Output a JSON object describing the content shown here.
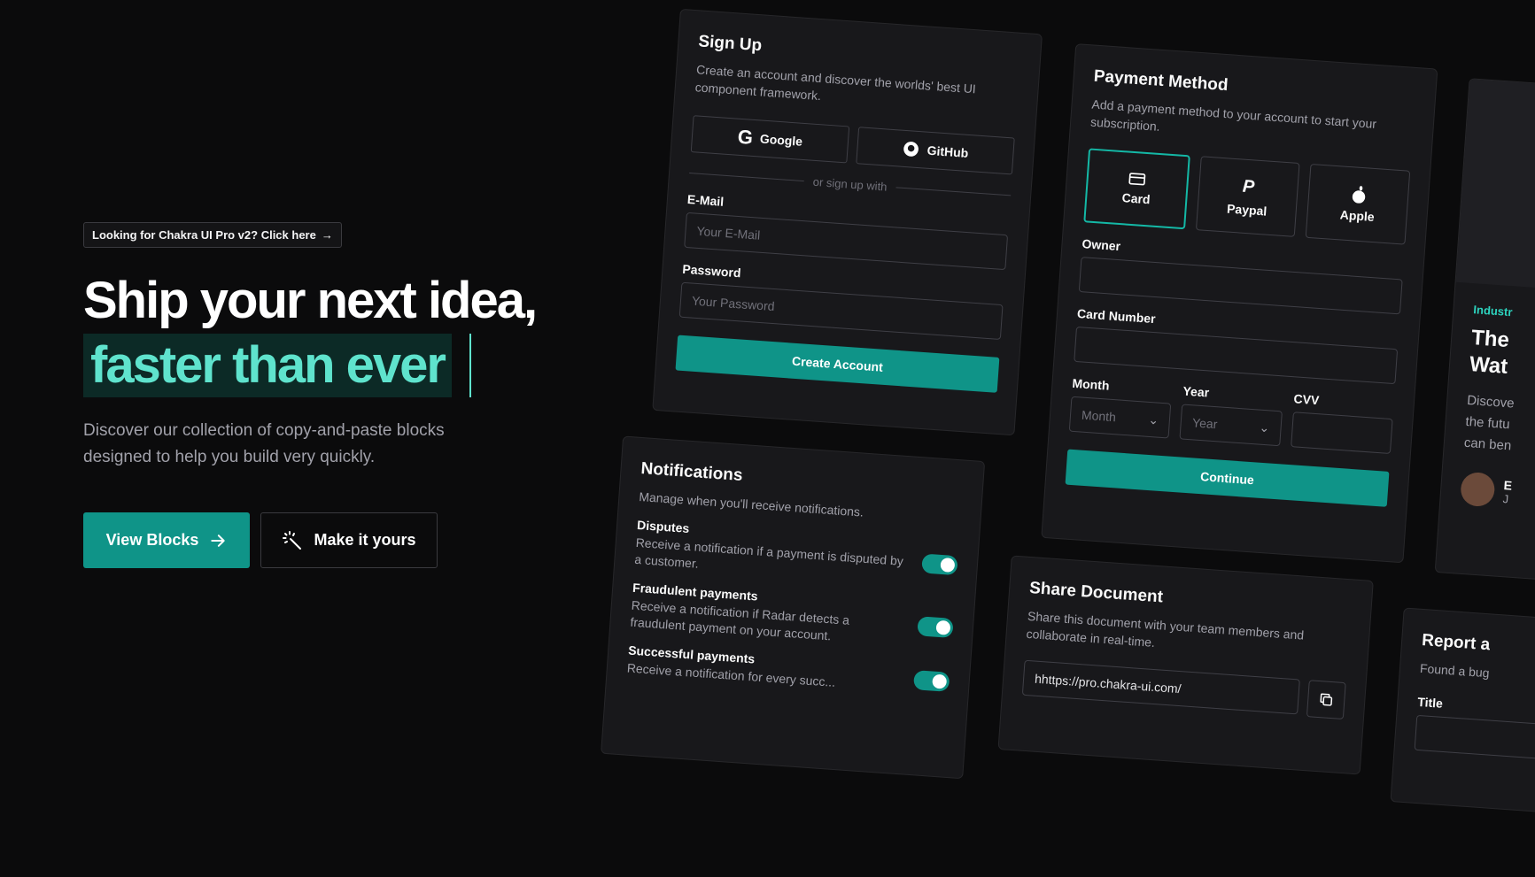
{
  "hero": {
    "promo_label": "Looking for Chakra UI Pro v2? Click here",
    "headline_line1": "Ship your next idea,",
    "headline_line2": "faster than ever",
    "subtitle": "Discover our collection of copy-and-paste blocks designed to help you build very quickly.",
    "primary_button": "View Blocks",
    "secondary_button": "Make it yours"
  },
  "signup": {
    "title": "Sign Up",
    "description": "Create an account and discover the worlds' best UI component framework.",
    "google_label": "Google",
    "github_label": "GitHub",
    "divider": "or sign up with",
    "email_label": "E-Mail",
    "email_placeholder": "Your E-Mail",
    "password_label": "Password",
    "password_placeholder": "Your Password",
    "submit": "Create Account"
  },
  "payment": {
    "title": "Payment Method",
    "description": "Add a payment method to your account to start your subscription.",
    "options": [
      {
        "label": "Card",
        "icon": "card-icon",
        "selected": true
      },
      {
        "label": "Paypal",
        "icon": "paypal-icon",
        "selected": false
      },
      {
        "label": "Apple",
        "icon": "apple-icon",
        "selected": false
      }
    ],
    "owner_label": "Owner",
    "card_number_label": "Card Number",
    "month_label": "Month",
    "month_value": "Month",
    "year_label": "Year",
    "year_value": "Year",
    "cvv_label": "CVV",
    "submit": "Continue"
  },
  "notifications": {
    "title": "Notifications",
    "description": "Manage when you'll receive notifications.",
    "items": [
      {
        "title": "Disputes",
        "description": "Receive a notification if a payment is disputed by a customer.",
        "enabled": true
      },
      {
        "title": "Fraudulent payments",
        "description": "Receive a notification if Radar detects a fraudulent payment on your account.",
        "enabled": true
      },
      {
        "title": "Successful payments",
        "description": "Receive a notification for every succ...",
        "enabled": true
      }
    ]
  },
  "share": {
    "title": "Share Document",
    "description": "Share this document with your team members and collaborate in real-time.",
    "link_value": "hhttps://pro.chakra-ui.com/"
  },
  "blog_preview": {
    "tag": "Industr",
    "title_line1": "The",
    "title_line2": "Wat",
    "desc_line1": "Discove",
    "desc_line2": "the futu",
    "desc_line3": "can ben",
    "author_initial": "E",
    "author_sub": "J"
  },
  "report": {
    "title": "Report a",
    "description": "Found a bug",
    "title_label": "Title"
  },
  "colors": {
    "background": "#0b0b0c",
    "accent": "#0f9488",
    "accent_light": "#5fe3cd"
  }
}
